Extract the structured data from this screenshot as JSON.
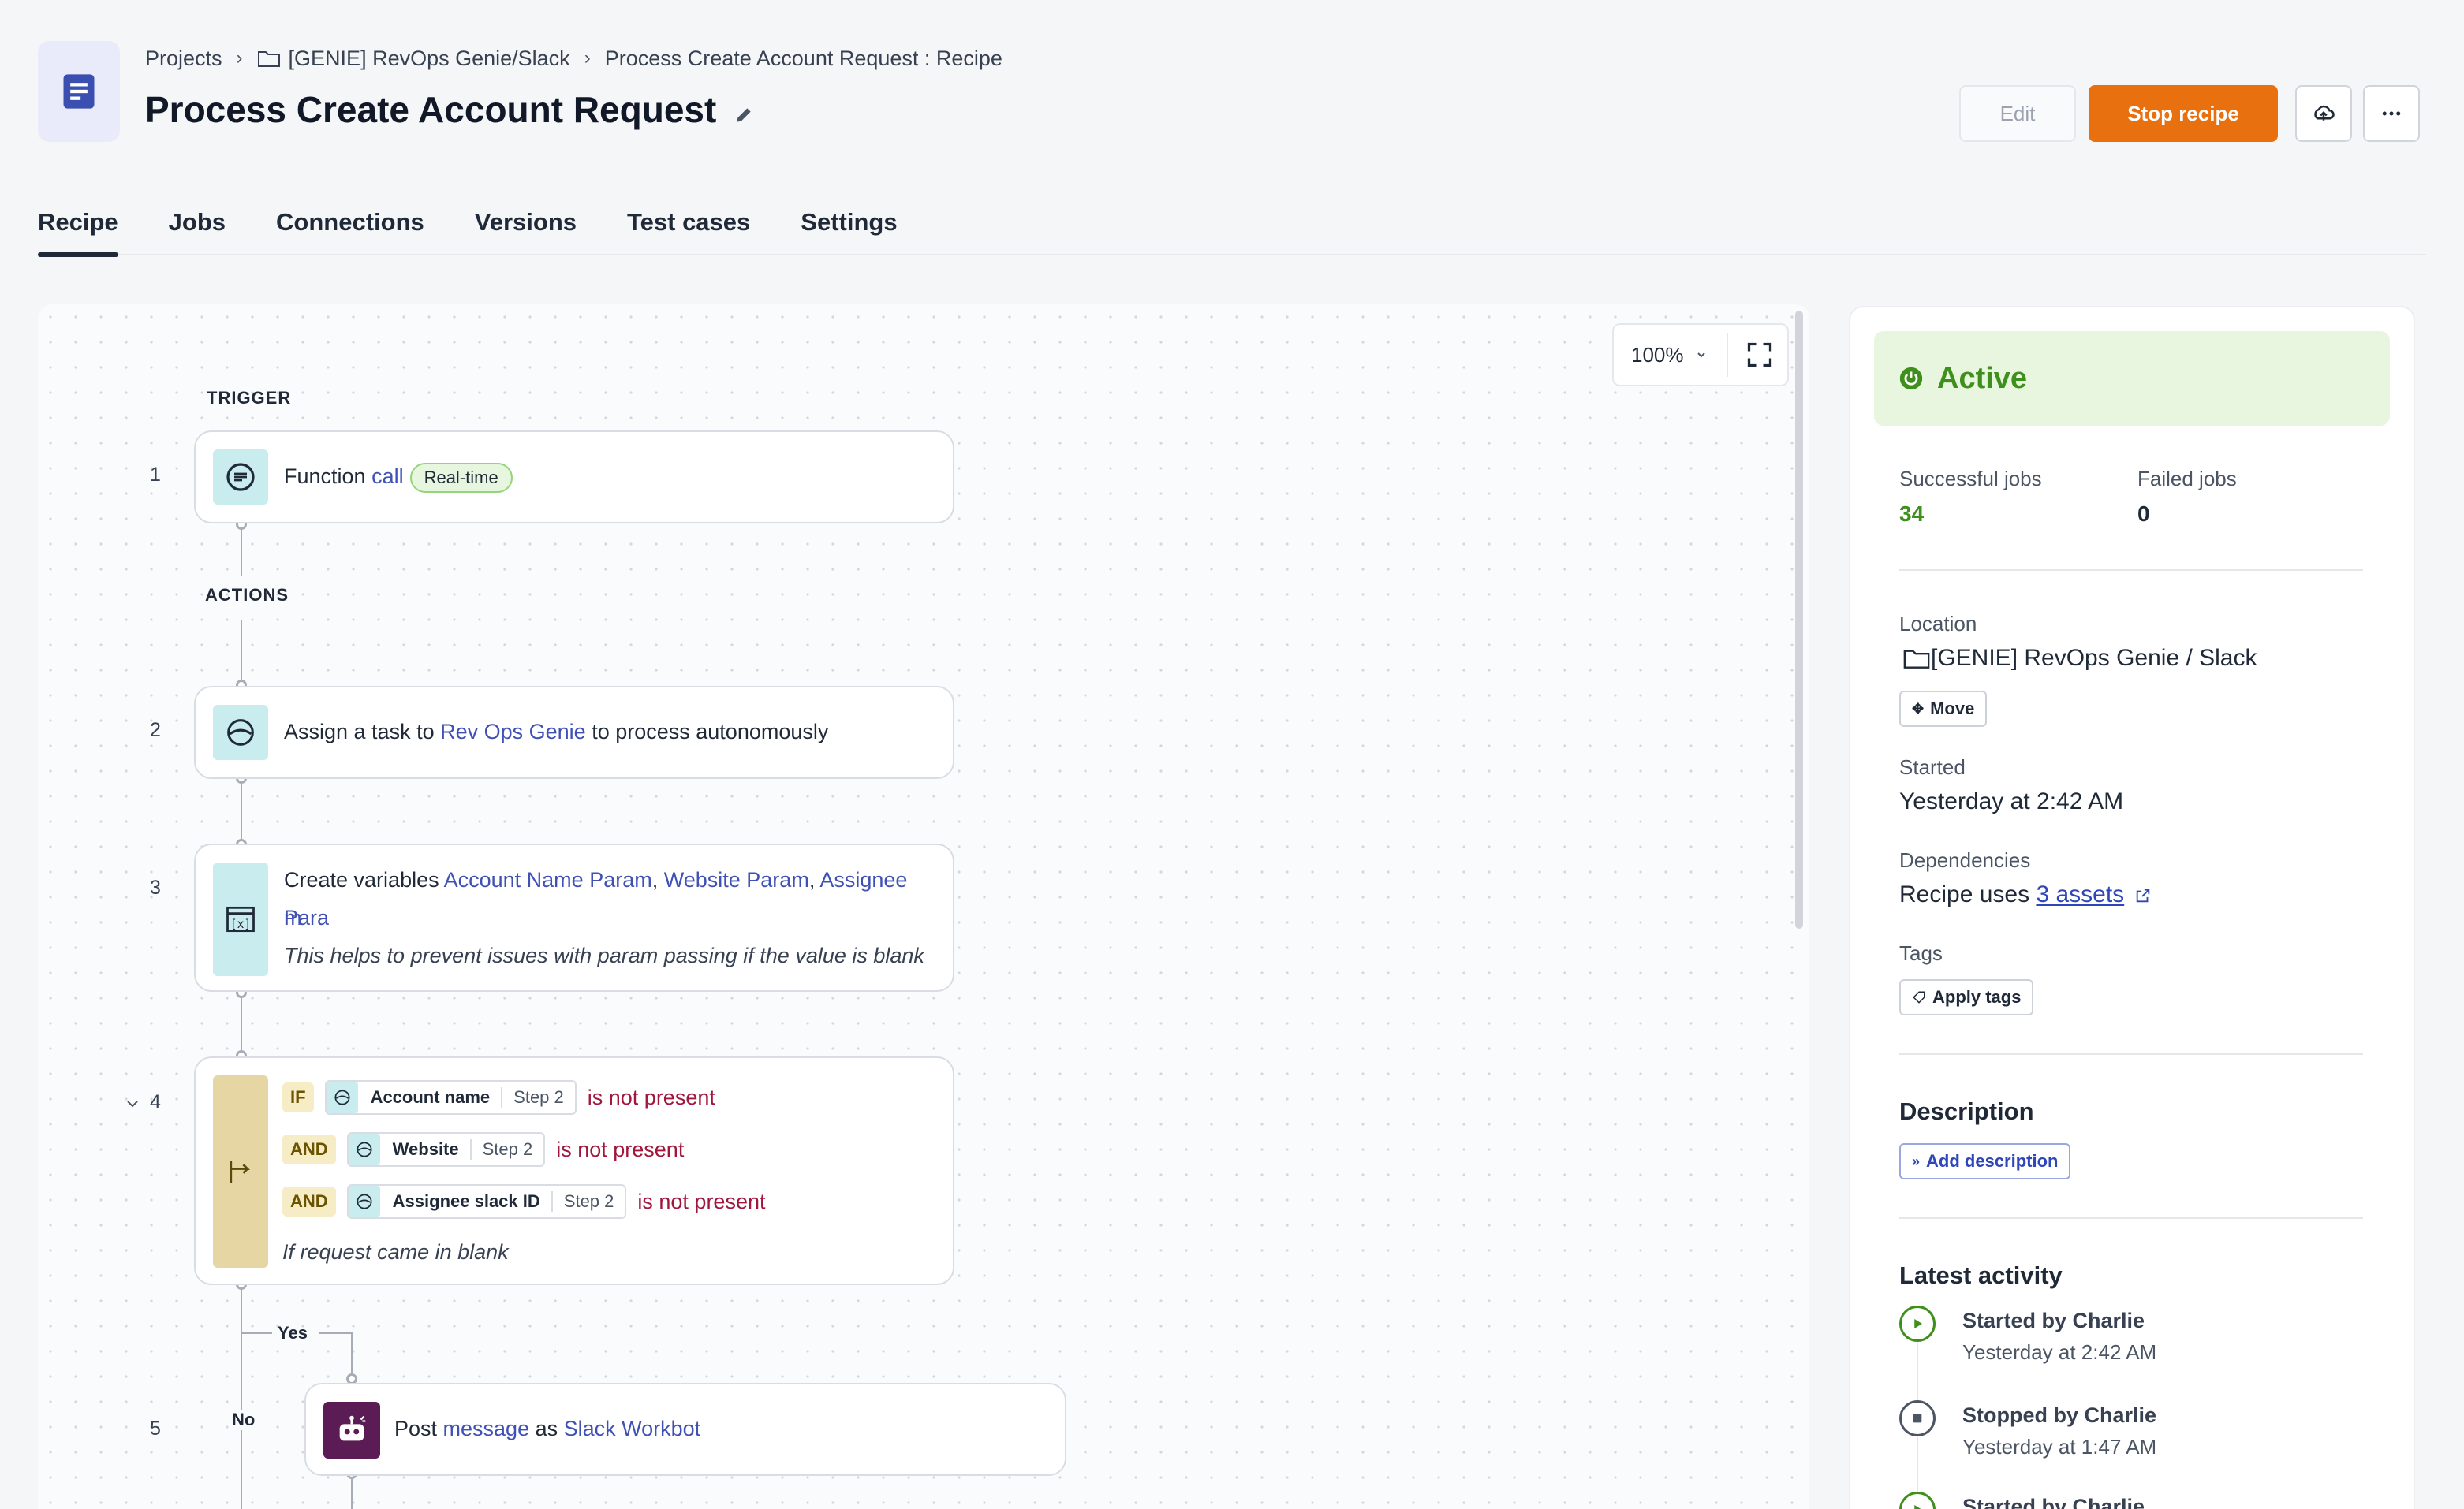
{
  "breadcrumb": {
    "projects": "Projects",
    "folder": "[GENIE] RevOps Genie/Slack",
    "current": "Process Create Account Request : Recipe"
  },
  "title": "Process Create Account Request",
  "actions": {
    "edit": "Edit",
    "stop": "Stop recipe"
  },
  "tabs": [
    "Recipe",
    "Jobs",
    "Connections",
    "Versions",
    "Test cases",
    "Settings"
  ],
  "canvas": {
    "zoom": "100%",
    "trigger_label": "TRIGGER",
    "actions_label": "ACTIONS",
    "steps": {
      "s1": {
        "num": "1",
        "prefix": "Function ",
        "link": "call",
        "badge": "Real-time"
      },
      "s2": {
        "num": "2",
        "prefix": "Assign a task to ",
        "link": "Rev Ops Genie",
        "suffix": " to process autonomously"
      },
      "s3": {
        "num": "3",
        "prefix": "Create variables ",
        "link1": "Account Name Param",
        "sep1": ", ",
        "link2": "Website Param",
        "sep2": ", ",
        "link3a": "Assignee Para",
        "link3b": "m",
        "note": "This helps to prevent issues with param passing if the value is blank"
      },
      "s4": {
        "num": "4",
        "conditions": [
          {
            "op": "IF",
            "field": "Account name",
            "step": "Step 2",
            "check": "is not present"
          },
          {
            "op": "AND",
            "field": "Website",
            "step": "Step 2",
            "check": "is not present"
          },
          {
            "op": "AND",
            "field": "Assignee slack ID",
            "step": "Step 2",
            "check": "is not present"
          }
        ],
        "note": "If request came in blank",
        "yes": "Yes",
        "no": "No"
      },
      "s5": {
        "num": "5",
        "prefix": "Post ",
        "link1": "message",
        "mid": " as ",
        "link2": "Slack Workbot"
      }
    }
  },
  "panel": {
    "status": "Active",
    "successful_label": "Successful jobs",
    "successful_value": "34",
    "failed_label": "Failed jobs",
    "failed_value": "0",
    "location_label": "Location",
    "location_value": "[GENIE] RevOps Genie / Slack",
    "move": "Move",
    "started_label": "Started",
    "started_value": "Yesterday at 2:42 AM",
    "dependencies_label": "Dependencies",
    "dependencies_prefix": "Recipe uses ",
    "dependencies_link": "3 assets",
    "tags_label": "Tags",
    "apply_tags": "Apply tags",
    "description_heading": "Description",
    "add_description": "Add description",
    "activity_heading": "Latest activity",
    "activity": [
      {
        "title": "Started by Charlie",
        "time": "Yesterday at 2:42 AM"
      },
      {
        "title": "Stopped by Charlie",
        "time": "Yesterday at 1:47 AM"
      },
      {
        "title": "Started by Charlie",
        "time": ""
      }
    ]
  },
  "colors": {
    "accent_orange": "#e8700f",
    "active_green": "#3f8f1c",
    "link_blue": "#3f51b5",
    "condition_red": "#a1163e"
  }
}
